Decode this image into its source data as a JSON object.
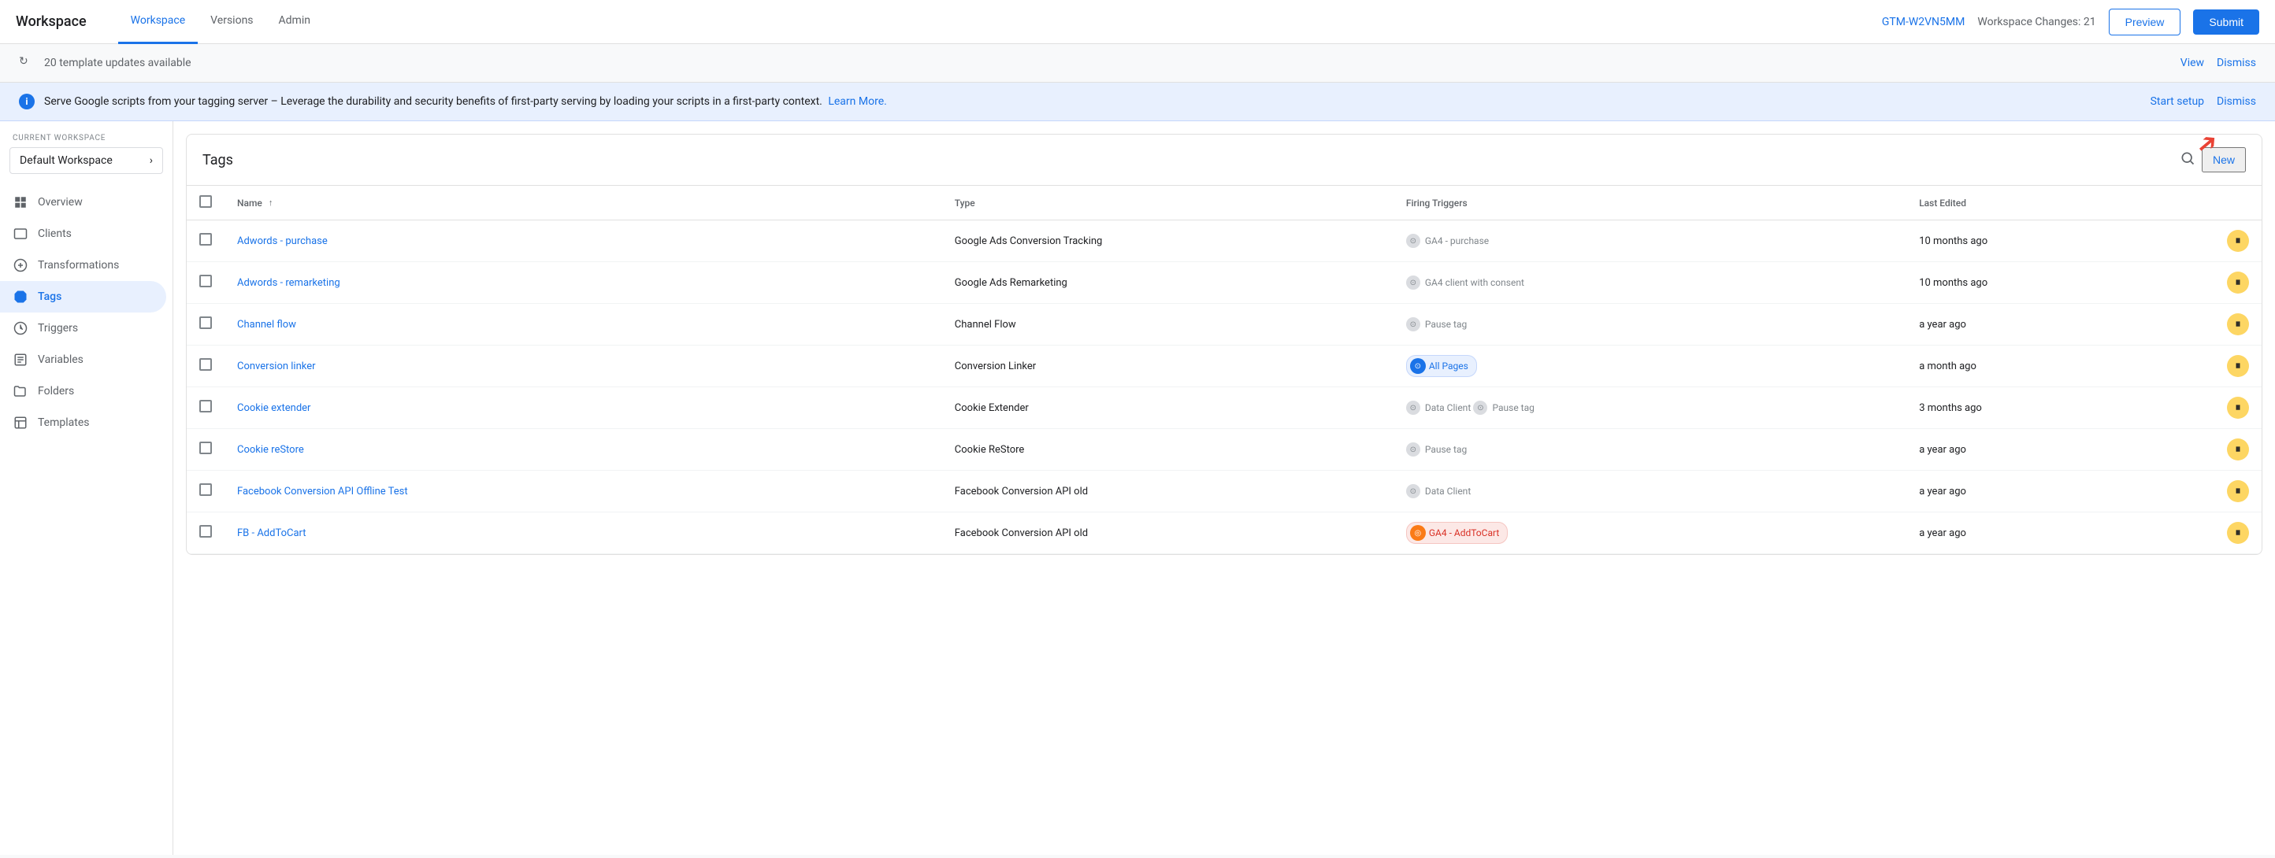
{
  "app": {
    "title": "Workspace"
  },
  "topnav": {
    "tabs": [
      {
        "label": "Workspace",
        "active": true
      },
      {
        "label": "Versions",
        "active": false
      },
      {
        "label": "Admin",
        "active": false
      }
    ],
    "gtm_id": "GTM-W2VN5MM",
    "workspace_changes_label": "Workspace Changes: 21",
    "preview_label": "Preview",
    "submit_label": "Submit"
  },
  "banners": {
    "updates": {
      "text": "20 template updates available",
      "view_label": "View",
      "dismiss_label": "Dismiss"
    },
    "info": {
      "text": "Serve Google scripts from your tagging server – Leverage the durability and security benefits of first-party serving by loading your scripts in a first-party context.",
      "link_label": "Learn More.",
      "start_setup_label": "Start setup",
      "dismiss_label": "Dismiss"
    }
  },
  "sidebar": {
    "current_workspace_label": "CURRENT WORKSPACE",
    "workspace_name": "Default Workspace",
    "items": [
      {
        "label": "Overview",
        "icon": "overview"
      },
      {
        "label": "Clients",
        "icon": "clients"
      },
      {
        "label": "Transformations",
        "icon": "transformations"
      },
      {
        "label": "Tags",
        "icon": "tags",
        "active": true
      },
      {
        "label": "Triggers",
        "icon": "triggers"
      },
      {
        "label": "Variables",
        "icon": "variables"
      },
      {
        "label": "Folders",
        "icon": "folders"
      },
      {
        "label": "Templates",
        "icon": "templates"
      }
    ]
  },
  "tags": {
    "title": "Tags",
    "new_label": "New",
    "columns": {
      "name": "Name",
      "type": "Type",
      "firing_triggers": "Firing Triggers",
      "last_edited": "Last Edited"
    },
    "rows": [
      {
        "name": "Adwords - purchase",
        "type": "Google Ads Conversion Tracking",
        "triggers": [
          {
            "label": "GA4 - purchase",
            "style": "gray"
          }
        ],
        "last_edited": "10 months ago",
        "status": "yellow"
      },
      {
        "name": "Adwords - remarketing",
        "type": "Google Ads Remarketing",
        "triggers": [
          {
            "label": "GA4 client with consent",
            "style": "gray"
          }
        ],
        "last_edited": "10 months ago",
        "status": "yellow"
      },
      {
        "name": "Channel flow",
        "type": "Channel Flow",
        "triggers": [
          {
            "label": "Pause tag",
            "style": "gray"
          }
        ],
        "last_edited": "a year ago",
        "status": "yellow"
      },
      {
        "name": "Conversion linker",
        "type": "Conversion Linker",
        "triggers": [
          {
            "label": "All Pages",
            "style": "blue"
          }
        ],
        "last_edited": "a month ago",
        "status": "yellow"
      },
      {
        "name": "Cookie extender",
        "type": "Cookie Extender",
        "triggers": [
          {
            "label": "Data Client",
            "style": "gray"
          },
          {
            "label": "Pause tag",
            "style": "gray"
          }
        ],
        "last_edited": "3 months ago",
        "status": "yellow"
      },
      {
        "name": "Cookie reStore",
        "type": "Cookie ReStore",
        "triggers": [
          {
            "label": "Pause tag",
            "style": "gray"
          }
        ],
        "last_edited": "a year ago",
        "status": "yellow"
      },
      {
        "name": "Facebook Conversion API Offline Test",
        "type": "Facebook Conversion API old",
        "triggers": [
          {
            "label": "Data Client",
            "style": "gray"
          }
        ],
        "last_edited": "a year ago",
        "status": "yellow"
      },
      {
        "name": "FB - AddToCart",
        "type": "Facebook Conversion API old",
        "triggers": [
          {
            "label": "GA4 - AddToCart",
            "style": "orange"
          }
        ],
        "last_edited": "a year ago",
        "status": "yellow"
      }
    ]
  }
}
